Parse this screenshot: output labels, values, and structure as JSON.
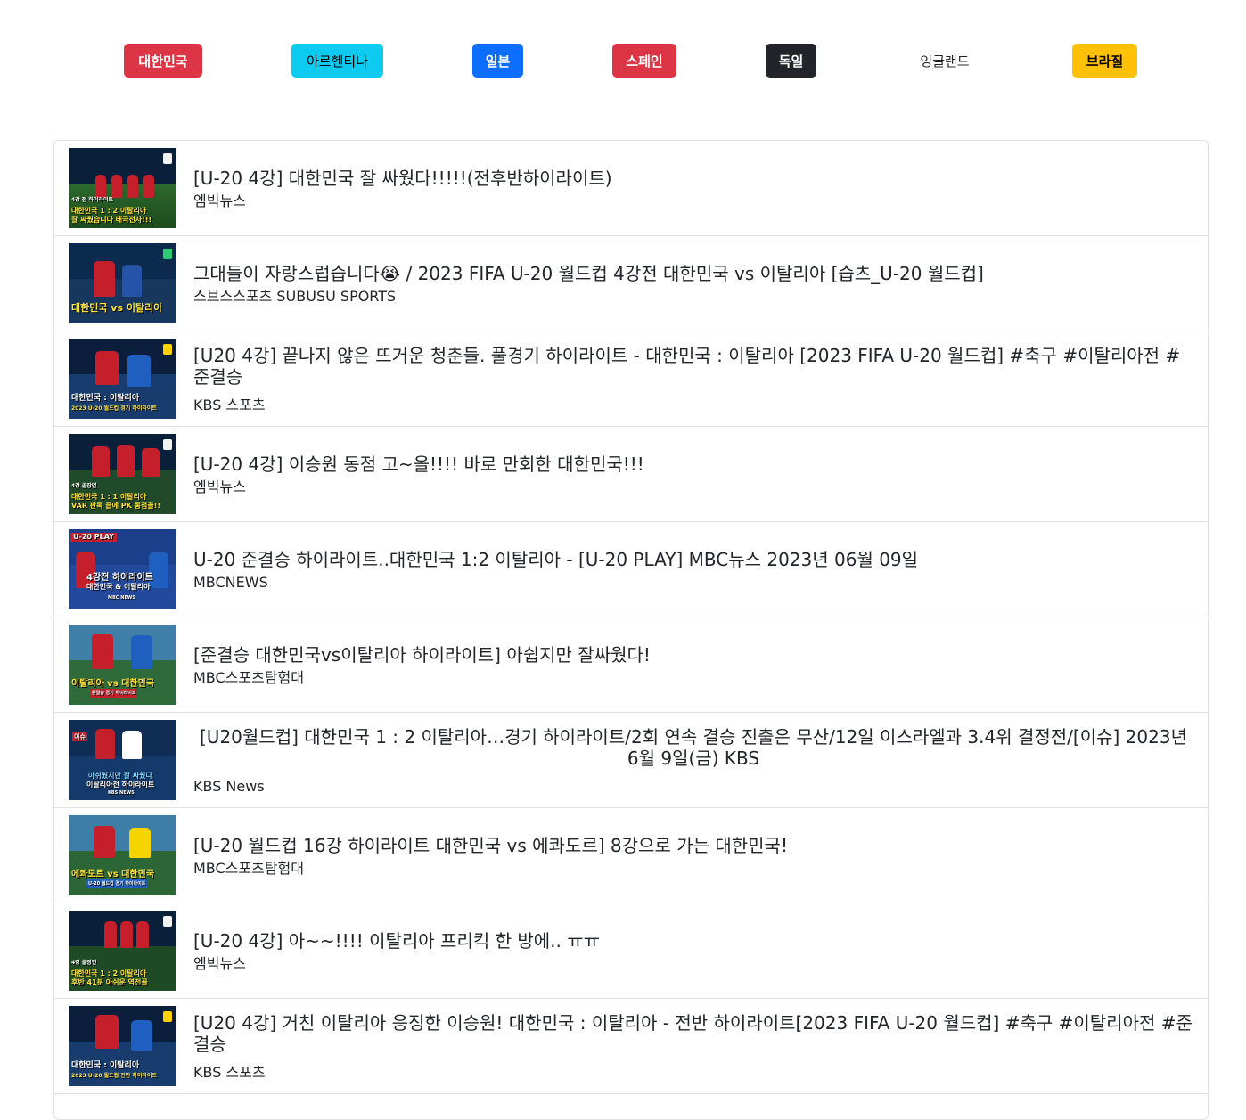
{
  "countries": [
    {
      "label": "대한민국",
      "color": "#dc3545"
    },
    {
      "label": "아르헨티나",
      "color": "#0dcaf0"
    },
    {
      "label": "일본",
      "color": "#0d6efd"
    },
    {
      "label": "스페인",
      "color": "#dc3545"
    },
    {
      "label": "독일",
      "color": "#212529"
    },
    {
      "label": "잉글랜드",
      "color": "transparent"
    },
    {
      "label": "브라질",
      "color": "#ffc107"
    }
  ],
  "videos": [
    {
      "title": "[U-20 4강] 대한민국 잘 싸웠다!!!!!(전후반하이라이트)",
      "channel": "엠빅뉴스",
      "thumb_text": [
        "4강 전 하이라이트",
        "대한민국 1 : 2 이탈리아",
        "잘 싸웠습니다 태극전사!!!"
      ]
    },
    {
      "title": "그대들이 자랑스럽습니다😭 / 2023 FIFA U-20 월드컵 4강전 대한민국 vs 이탈리아 [습츠_U-20 월드컵]",
      "channel": "스브스스포츠 SUBUSU SPORTS",
      "thumb_text": [
        "대한민국 vs 이탈리아"
      ]
    },
    {
      "title": "[U20 4강] 끝나지 않은 뜨거운 청춘들. 풀경기 하이라이트 - 대한민국 : 이탈리아 [2023 FIFA U-20 월드컵] #축구 #이탈리아전 #준결승",
      "channel": "KBS 스포츠",
      "thumb_text": [
        "대한민국 : 이탈리아",
        "2023 U-20 월드컵 경기 하이라이트"
      ]
    },
    {
      "title": "[U-20 4강] 이승원 동점 고~올!!!! 바로 만회한 대한민국!!!",
      "channel": "엠빅뉴스",
      "thumb_text": [
        "4강 골장면",
        "대한민국 1 : 1 이탈리아",
        "VAR 판독 끝에 PK 동점골!!"
      ]
    },
    {
      "title": "U-20 준결승 하이라이트..대한민국 1:2 이탈리아 - [U-20 PLAY] MBC뉴스 2023년 06월 09일",
      "channel": "MBCNEWS",
      "thumb_text": [
        "U-20 PLAY",
        "4강전 하이라이트",
        "대한민국 & 이탈리아",
        "MBC NEWS"
      ]
    },
    {
      "title": "[준결승 대한민국vs이탈리아 하이라이트] 아쉽지만 잘싸웠다!",
      "channel": "MBC스포츠탐험대",
      "thumb_text": [
        "이탈리아 vs 대한민국",
        "준결승 경기 하이라이트"
      ]
    },
    {
      "title": "[U20월드컵] 대한민국 1 : 2 이탈리아…경기 하이라이트/2회 연속 결승 진출은 무산/12일 이스라엘과 3.4위 결정전/[이슈] 2023년 6월 9일(금) KBS",
      "channel": "KBS News",
      "thumb_text": [
        "이슈",
        "아쉬웠지만 잘 싸웠다",
        "이탈리아전 하이라이트",
        "KBS NEWS"
      ]
    },
    {
      "title": "[U-20 월드컵 16강 하이라이트 대한민국 vs 에콰도르] 8강으로 가는 대한민국!",
      "channel": "MBC스포츠탐험대",
      "thumb_text": [
        "에콰도르 vs 대한민국",
        "U-20 월드컵 경기 하이라이트"
      ]
    },
    {
      "title": "[U-20 4강] 아~~!!!! 이탈리아 프리킥 한 방에.. ㅠㅠ",
      "channel": "엠빅뉴스",
      "thumb_text": [
        "4강 골장면",
        "대한민국 1 : 2 이탈리아",
        "후반 41분 아쉬운 역전골"
      ]
    },
    {
      "title": "[U20 4강] 거친 이탈리아 응징한 이승원! 대한민국 : 이탈리아 - 전반 하이라이트[2023 FIFA U-20 월드컵] #축구 #이탈리아전 #준결승",
      "channel": "KBS 스포츠",
      "thumb_text": [
        "대한민국 : 이탈리아",
        "2023 U-20 월드컵 전반 하이라이트"
      ]
    }
  ]
}
